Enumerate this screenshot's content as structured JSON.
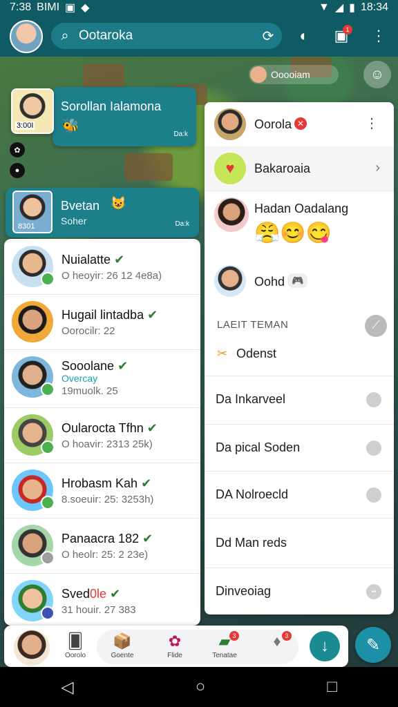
{
  "status_bar": {
    "time_left": "7:38",
    "carrier": "BIMI",
    "time_right": "18:34",
    "wifi_icon": "wifi-icon",
    "signal_icon": "signal-icon",
    "battery_icon": "battery-icon"
  },
  "app_bar": {
    "search_text": "Ootaroka",
    "notification_count": "1"
  },
  "map_chip": {
    "label": "Ooooiam"
  },
  "chat_cards": [
    {
      "title": "Sorollan Ialamona",
      "pic_label": "3:00I",
      "meta": "Da:k",
      "emoji": "🐝"
    },
    {
      "title": "Bvetan",
      "subtitle": "Soher",
      "pic_label": "8301",
      "meta": "Da:k",
      "emoji": "😺"
    }
  ],
  "friends": [
    {
      "name": "Nuialatte",
      "detail": "O heoyir: 26 12 4e8a)",
      "color": "#4caf50"
    },
    {
      "name": "Hugail lintadba",
      "detail": "Oorocilr: 22",
      "color": "#4caf50"
    },
    {
      "name": "Sooolane",
      "tag": "Overcay",
      "detail": "19muolk. 25",
      "color": "#4caf50"
    },
    {
      "name": "Oularocta Tfhn",
      "detail": "O hoavir: 2313 25k)",
      "color": "#4caf50"
    },
    {
      "name": "Hrobasm Kah",
      "detail": "8.soeuir: 25: 3253h)",
      "color": "#4caf50"
    },
    {
      "name": "Panaacra 182",
      "detail": "O heolr: 25: 2 23e)",
      "color": "#9e9e9e"
    },
    {
      "name": "Sved",
      "name_highlight": "0le",
      "detail": "31 houir. 27 383",
      "color": "#3f51b5"
    }
  ],
  "dock": {
    "items": [
      {
        "label": "Oorolo",
        "icon": "card-icon"
      },
      {
        "label": "Goente",
        "icon": "box-icon"
      },
      {
        "label": "Flide",
        "icon": "flower-icon"
      },
      {
        "label": "Tenatae",
        "icon": "chat-icon",
        "badge": "3"
      },
      {
        "label": "",
        "icon": "bell-icon",
        "badge": "3"
      }
    ]
  },
  "menu": {
    "header_user": "Oorola",
    "items": [
      {
        "label": "Bakaroaia"
      },
      {
        "label": "Hadan Oadalang"
      },
      {
        "label": "Oohd",
        "chip": "🎮"
      }
    ],
    "section_title": "LAEIT TEMAN",
    "section_entry": "Odenst",
    "list": [
      {
        "label": "Da Inkarveel"
      },
      {
        "label": "Da pical Soden"
      },
      {
        "label": "DA Nolroecld"
      },
      {
        "label": "Dd Man reds"
      },
      {
        "label": "Dinveoiag"
      }
    ]
  },
  "colors": {
    "teal": "#0f5a63",
    "accent": "#1d7f8a",
    "online": "#4caf50"
  }
}
